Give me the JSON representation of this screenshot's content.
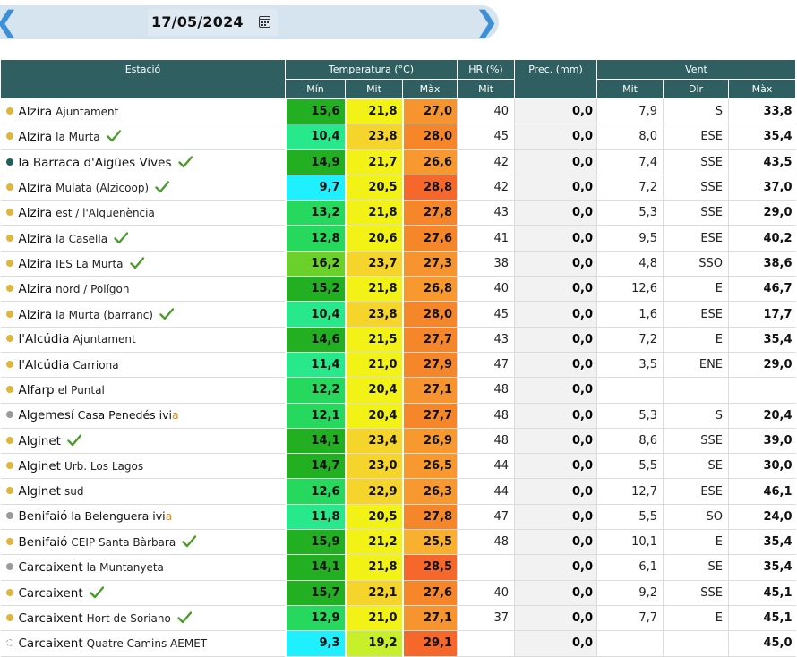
{
  "date": "17/05/2024",
  "headers": {
    "station": "Estació",
    "temperature": "Temperatura (°C)",
    "hr": "HR (%)",
    "prec": "Prec. (mm)",
    "wind": "Vent",
    "t_min": "Mín",
    "t_mit": "Mit",
    "t_max": "Màx",
    "hr_mit": "Mit",
    "w_mit": "Mit",
    "w_dir": "Dir",
    "w_max": "Màx"
  },
  "colors": {
    "dot_yellow": "#e0b53a",
    "dot_teal": "#1c5f5d",
    "dot_gray": "#9a9a9a",
    "check": "#4a9c2a",
    "header_bg": "#2f5f60"
  },
  "rows": [
    {
      "town": "Alzira",
      "sub": "Ajuntament",
      "dot": "yellow",
      "check": false,
      "ivia": false,
      "tmin": "15,6",
      "tmit": "21,8",
      "tmax": "27,0",
      "hr": "40",
      "prec": "0,0",
      "wmit": "7,9",
      "wdir": "S",
      "wmax": "33,8",
      "cmin": "#22b022",
      "cmit": "#f2f216",
      "cmax": "#f6952f"
    },
    {
      "town": "Alzira",
      "sub": "la Murta",
      "dot": "yellow",
      "check": true,
      "ivia": false,
      "tmin": "10,4",
      "tmit": "23,8",
      "tmax": "28,0",
      "hr": "45",
      "prec": "0,0",
      "wmit": "8,0",
      "wdir": "ESE",
      "wmax": "35,4",
      "cmin": "#27e88a",
      "cmit": "#f5d42c",
      "cmax": "#f6862a"
    },
    {
      "town": "la Barraca d'Aigües Vives",
      "sub": "",
      "dot": "teal",
      "check": true,
      "ivia": false,
      "tmin": "14,9",
      "tmit": "21,7",
      "tmax": "26,6",
      "hr": "42",
      "prec": "0,0",
      "wmit": "7,4",
      "wdir": "SSE",
      "wmax": "43,5",
      "cmin": "#22b022",
      "cmit": "#f2f216",
      "cmax": "#f7992f"
    },
    {
      "town": "Alzira",
      "sub": "Mulata (Alzicoop)",
      "dot": "yellow",
      "check": true,
      "ivia": false,
      "tmin": "9,7",
      "tmit": "20,5",
      "tmax": "28,8",
      "hr": "42",
      "prec": "0,0",
      "wmit": "7,2",
      "wdir": "SSE",
      "wmax": "37,0",
      "cmin": "#1ef0ff",
      "cmit": "#f2f216",
      "cmax": "#f5672a"
    },
    {
      "town": "Alzira",
      "sub": "est / l'Alquenència",
      "dot": "yellow",
      "check": false,
      "ivia": false,
      "tmin": "13,2",
      "tmit": "21,8",
      "tmax": "27,8",
      "hr": "43",
      "prec": "0,0",
      "wmit": "5,3",
      "wdir": "SSE",
      "wmax": "29,0",
      "cmin": "#26d85e",
      "cmit": "#f2f216",
      "cmax": "#f6862a"
    },
    {
      "town": "Alzira",
      "sub": "la Casella",
      "dot": "yellow",
      "check": true,
      "ivia": false,
      "tmin": "12,8",
      "tmit": "20,6",
      "tmax": "27,6",
      "hr": "41",
      "prec": "0,0",
      "wmit": "9,5",
      "wdir": "ESE",
      "wmax": "40,2",
      "cmin": "#26d85e",
      "cmit": "#f2f216",
      "cmax": "#f6862a"
    },
    {
      "town": "Alzira",
      "sub": "IES La Murta",
      "dot": "yellow",
      "check": true,
      "ivia": false,
      "tmin": "16,2",
      "tmit": "23,7",
      "tmax": "27,3",
      "hr": "38",
      "prec": "0,0",
      "wmit": "4,8",
      "wdir": "SSO",
      "wmax": "38,6",
      "cmin": "#6cd02a",
      "cmit": "#f5d42c",
      "cmax": "#f6952f"
    },
    {
      "town": "Alzira",
      "sub": "nord / Polígon",
      "dot": "yellow",
      "check": false,
      "ivia": false,
      "tmin": "15,2",
      "tmit": "21,8",
      "tmax": "26,8",
      "hr": "40",
      "prec": "0,0",
      "wmit": "12,6",
      "wdir": "E",
      "wmax": "46,7",
      "cmin": "#22b022",
      "cmit": "#f2f216",
      "cmax": "#f7992f"
    },
    {
      "town": "Alzira",
      "sub": "la Murta (barranc)",
      "dot": "yellow",
      "check": true,
      "ivia": false,
      "tmin": "10,4",
      "tmit": "23,8",
      "tmax": "28,0",
      "hr": "45",
      "prec": "0,0",
      "wmit": "1,6",
      "wdir": "ESE",
      "wmax": "17,7",
      "cmin": "#27e88a",
      "cmit": "#f5d42c",
      "cmax": "#f6862a"
    },
    {
      "town": "l'Alcúdia",
      "sub": "Ajuntament",
      "dot": "yellow",
      "check": false,
      "ivia": false,
      "tmin": "14,6",
      "tmit": "21,5",
      "tmax": "27,7",
      "hr": "43",
      "prec": "0,0",
      "wmit": "7,2",
      "wdir": "E",
      "wmax": "35,4",
      "cmin": "#22b022",
      "cmit": "#f2f216",
      "cmax": "#f6862a"
    },
    {
      "town": "l'Alcúdia",
      "sub": "Carriona",
      "dot": "yellow",
      "check": false,
      "ivia": false,
      "tmin": "11,4",
      "tmit": "21,0",
      "tmax": "27,9",
      "hr": "47",
      "prec": "0,0",
      "wmit": "3,5",
      "wdir": "ENE",
      "wmax": "29,0",
      "cmin": "#27e88a",
      "cmit": "#f2f216",
      "cmax": "#f6862a"
    },
    {
      "town": "Alfarp",
      "sub": "el Puntal",
      "dot": "yellow",
      "check": false,
      "ivia": false,
      "tmin": "12,2",
      "tmit": "20,4",
      "tmax": "27,1",
      "hr": "48",
      "prec": "0,0",
      "wmit": "",
      "wdir": "",
      "wmax": "",
      "cmin": "#26d85e",
      "cmit": "#f2f216",
      "cmax": "#f6952f"
    },
    {
      "town": "Algemesí",
      "sub": "Casa Penedés",
      "dot": "gray",
      "check": false,
      "ivia": true,
      "tmin": "12,1",
      "tmit": "20,4",
      "tmax": "27,7",
      "hr": "48",
      "prec": "0,0",
      "wmit": "5,3",
      "wdir": "S",
      "wmax": "20,4",
      "cmin": "#26d85e",
      "cmit": "#f2f216",
      "cmax": "#f6862a"
    },
    {
      "town": "Alginet",
      "sub": "",
      "dot": "yellow",
      "check": true,
      "ivia": false,
      "tmin": "14,1",
      "tmit": "23,4",
      "tmax": "26,9",
      "hr": "48",
      "prec": "0,0",
      "wmit": "8,6",
      "wdir": "SSE",
      "wmax": "39,0",
      "cmin": "#22b022",
      "cmit": "#f5d42c",
      "cmax": "#f7992f"
    },
    {
      "town": "Alginet",
      "sub": "Urb. Los Lagos",
      "dot": "yellow",
      "check": false,
      "ivia": false,
      "tmin": "14,7",
      "tmit": "23,0",
      "tmax": "26,5",
      "hr": "44",
      "prec": "0,0",
      "wmit": "5,5",
      "wdir": "SE",
      "wmax": "30,0",
      "cmin": "#22b022",
      "cmit": "#f5d42c",
      "cmax": "#f7992f"
    },
    {
      "town": "Alginet",
      "sub": "sud",
      "dot": "yellow",
      "check": false,
      "ivia": false,
      "tmin": "12,6",
      "tmit": "22,9",
      "tmax": "26,3",
      "hr": "44",
      "prec": "0,0",
      "wmit": "12,7",
      "wdir": "ESE",
      "wmax": "46,1",
      "cmin": "#26d85e",
      "cmit": "#f5d42c",
      "cmax": "#f7992f"
    },
    {
      "town": "Benifaió",
      "sub": "la Belenguera",
      "dot": "gray",
      "check": false,
      "ivia": true,
      "tmin": "11,8",
      "tmit": "20,5",
      "tmax": "27,8",
      "hr": "47",
      "prec": "0,0",
      "wmit": "5,5",
      "wdir": "SO",
      "wmax": "24,0",
      "cmin": "#27e88a",
      "cmit": "#f2f216",
      "cmax": "#f6862a"
    },
    {
      "town": "Benifaió",
      "sub": "CEIP Santa Bàrbara",
      "dot": "yellow",
      "check": true,
      "ivia": false,
      "tmin": "15,9",
      "tmit": "21,2",
      "tmax": "25,5",
      "hr": "48",
      "prec": "0,0",
      "wmit": "10,1",
      "wdir": "E",
      "wmax": "35,4",
      "cmin": "#22b022",
      "cmit": "#f2f216",
      "cmax": "#f7b12e"
    },
    {
      "town": "Carcaixent",
      "sub": "la Muntanyeta",
      "dot": "gray",
      "check": false,
      "ivia": false,
      "tmin": "14,1",
      "tmit": "21,8",
      "tmax": "28,5",
      "hr": "",
      "prec": "0,0",
      "wmit": "6,1",
      "wdir": "SE",
      "wmax": "35,4",
      "cmin": "#22b022",
      "cmit": "#f2f216",
      "cmax": "#f5672a"
    },
    {
      "town": "Carcaixent",
      "sub": "",
      "dot": "yellow",
      "check": true,
      "ivia": false,
      "tmin": "15,7",
      "tmit": "22,1",
      "tmax": "27,6",
      "hr": "40",
      "prec": "0,0",
      "wmit": "9,2",
      "wdir": "SSE",
      "wmax": "45,1",
      "cmin": "#22b022",
      "cmit": "#f5d42c",
      "cmax": "#f6862a"
    },
    {
      "town": "Carcaixent",
      "sub": "Hort de Soriano",
      "dot": "yellow",
      "check": true,
      "ivia": false,
      "tmin": "12,9",
      "tmit": "21,0",
      "tmax": "27,1",
      "hr": "37",
      "prec": "0,0",
      "wmit": "7,7",
      "wdir": "E",
      "wmax": "45,1",
      "cmin": "#26d85e",
      "cmit": "#f2f216",
      "cmax": "#f6952f"
    },
    {
      "town": "Carcaixent",
      "sub": "Quatre Camins AEMET",
      "dot": "empty",
      "check": false,
      "ivia": false,
      "tmin": "9,3",
      "tmit": "19,2",
      "tmax": "29,1",
      "hr": "",
      "prec": "0,0",
      "wmit": "",
      "wdir": "",
      "wmax": "45,0",
      "cmin": "#1ef0ff",
      "cmit": "#c8f02a",
      "cmax": "#f5672a"
    }
  ]
}
